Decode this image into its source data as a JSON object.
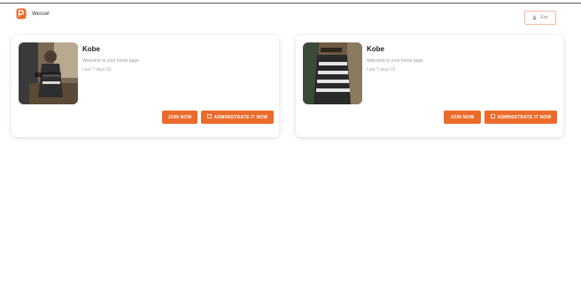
{
  "header": {
    "brand_name": "Wessel",
    "logo_icon": "brand-logo-icon",
    "user_button_label": "Exit"
  },
  "colors": {
    "accent": "#ec6a2a",
    "card_bg": "#ffffff"
  },
  "cards": [
    {
      "name": "Kobe",
      "subtitle": "Welcome to your home page",
      "meta": "Last 7 days 01",
      "join_label": "JOIN NOW",
      "admin_label": "ADMINISTRATE IT NOW"
    },
    {
      "name": "Kobe",
      "subtitle": "Welcome to your home page",
      "meta": "Last 7 days 01",
      "join_label": "JOIN NOW",
      "admin_label": "ADMINISTRATE IT NOW"
    }
  ]
}
